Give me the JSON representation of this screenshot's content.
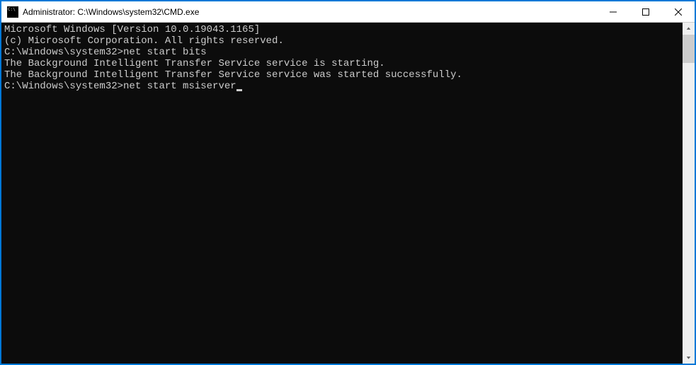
{
  "titlebar": {
    "title": "Administrator: C:\\Windows\\system32\\CMD.exe"
  },
  "terminal": {
    "lines": [
      "Microsoft Windows [Version 10.0.19043.1165]",
      "(c) Microsoft Corporation. All rights reserved.",
      ""
    ],
    "prompt1": "C:\\Windows\\system32>",
    "command1": "net start bits",
    "output": [
      "The Background Intelligent Transfer Service service is starting.",
      "The Background Intelligent Transfer Service service was started successfully.",
      "",
      ""
    ],
    "prompt2": "C:\\Windows\\system32>",
    "command2": "net start msiserver"
  }
}
